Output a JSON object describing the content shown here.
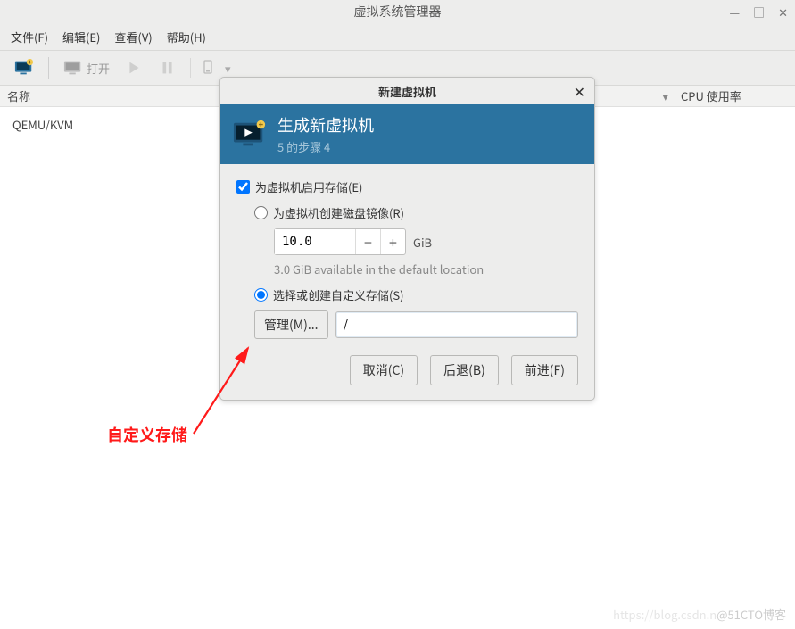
{
  "main": {
    "title": "虚拟系统管理器",
    "menubar": {
      "file": "文件(F)",
      "edit": "编辑(E)",
      "view": "查看(V)",
      "help": "帮助(H)"
    },
    "toolbar": {
      "open": "打开"
    },
    "columns": {
      "name": "名称",
      "cpu": "CPU 使用率"
    },
    "hosts": {
      "item0": "QEMU/KVM"
    }
  },
  "dialog": {
    "title": "新建虚拟机",
    "header": {
      "title": "生成新虚拟机",
      "step": "5 的步骤 4"
    },
    "storage": {
      "enable_label": "为虚拟机启用存储(E)",
      "create_disk_label": "为虚拟机创建磁盘镜像(R)",
      "size_value": "10.0",
      "size_unit": "GiB",
      "available_text": "3.0 GiB available in the default location",
      "custom_label": "选择或创建自定义存储(S)",
      "manage_btn": "管理(M)...",
      "path_value": "/"
    },
    "buttons": {
      "cancel": "取消(C)",
      "back": "后退(B)",
      "forward": "前进(F)"
    }
  },
  "annotation": {
    "label": "自定义存储"
  },
  "watermark": {
    "faint": "https://blog.csdn.n",
    "text": "@51CTO博客"
  }
}
